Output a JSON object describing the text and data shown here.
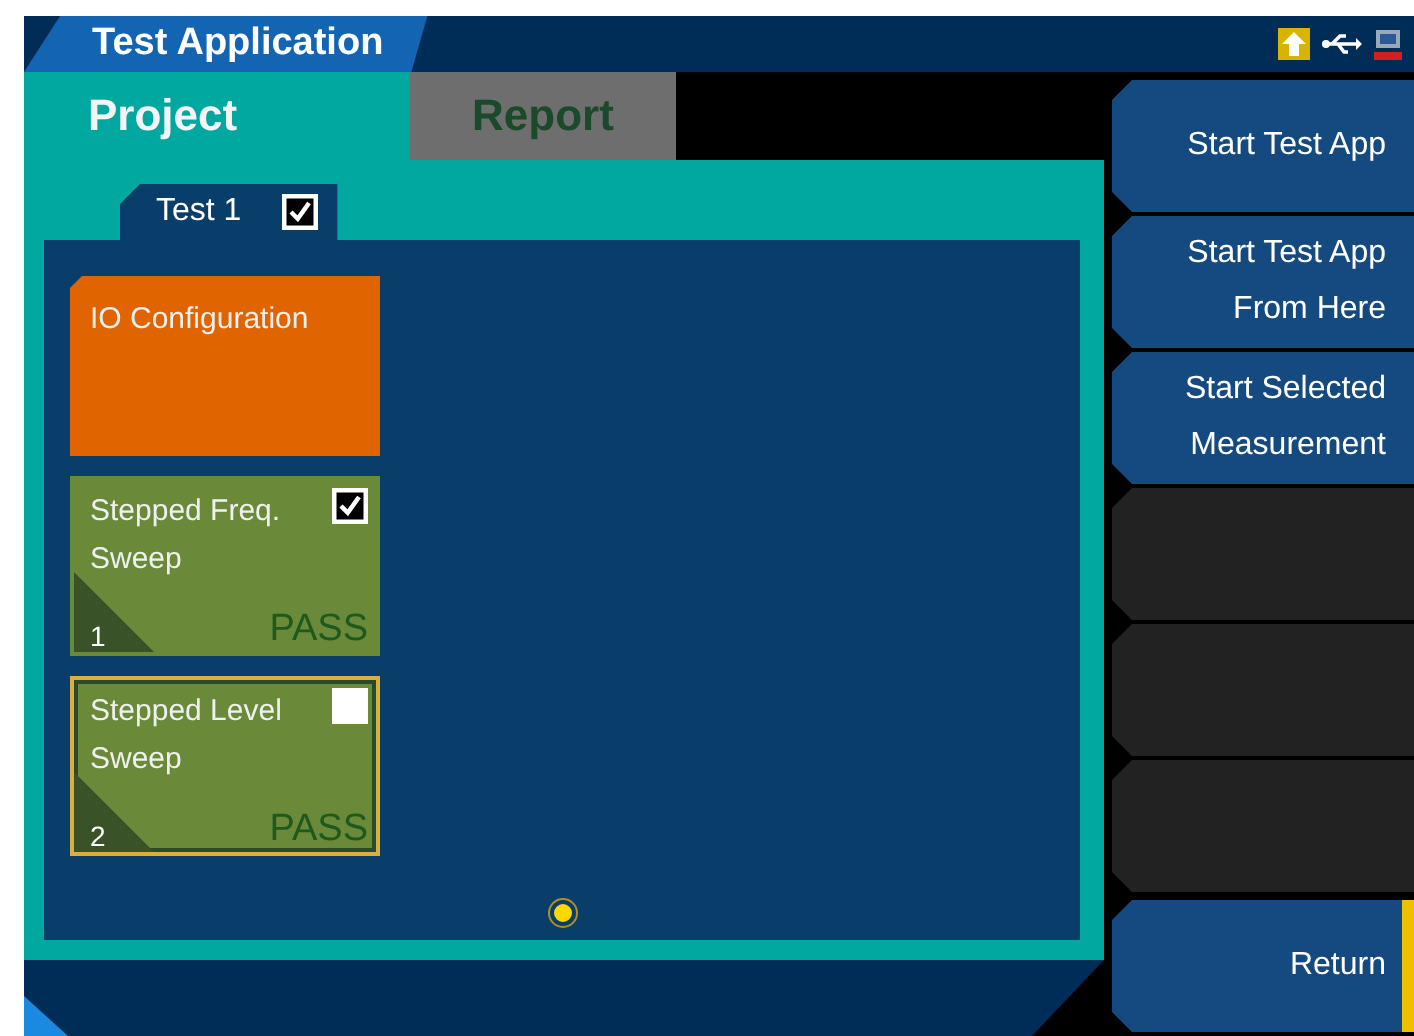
{
  "window": {
    "title": "Test Application"
  },
  "tabs": [
    {
      "label": "Project",
      "selected": true
    },
    {
      "label": "Report",
      "selected": false
    }
  ],
  "sub_tab": {
    "label": "Test 1",
    "checked": true
  },
  "cards": [
    {
      "kind": "config",
      "title": "IO Configuration"
    },
    {
      "kind": "measurement",
      "title": "Stepped Freq. Sweep",
      "checked": true,
      "selected": false,
      "number": "1",
      "result": "PASS"
    },
    {
      "kind": "measurement",
      "title": "Stepped Level Sweep",
      "checked": false,
      "selected": true,
      "number": "2",
      "result": "PASS"
    }
  ],
  "pages": [
    {
      "selected": true
    }
  ],
  "softkeys": [
    {
      "label": "Start Test App",
      "disabled": false
    },
    {
      "label": "Start Test App From Here",
      "disabled": false
    },
    {
      "label": "Start Selected Measurement",
      "disabled": false
    },
    {
      "disabled": true
    },
    {
      "disabled": true
    },
    {
      "disabled": true
    },
    {
      "label": "Return",
      "disabled": false,
      "highlighted": true
    }
  ]
}
